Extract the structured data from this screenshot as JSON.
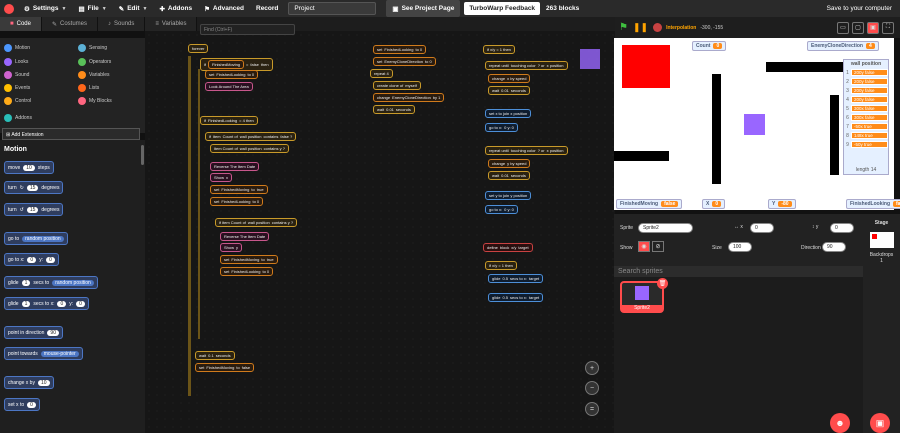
{
  "menu": {
    "settings": "Settings",
    "file": "File",
    "edit": "Edit",
    "addons": "Addons",
    "advanced": "Advanced",
    "record": "Record",
    "project_title": "Project",
    "see_project_page": "See Project Page",
    "feedback": "TurboWarp Feedback",
    "block_count": "263 blocks",
    "save": "Save to your computer"
  },
  "tabs": {
    "code": "Code",
    "costumes": "Costumes",
    "sounds": "Sounds",
    "variables": "Variables"
  },
  "find_placeholder": "Find (Ctrl+F)",
  "categories": [
    {
      "label": "Motion",
      "color": "#4c97ff"
    },
    {
      "label": "Looks",
      "color": "#9966ff"
    },
    {
      "label": "Sound",
      "color": "#cf63cf"
    },
    {
      "label": "Events",
      "color": "#ffbf00"
    },
    {
      "label": "Control",
      "color": "#ffab19"
    },
    {
      "label": "Sensing",
      "color": "#5cb1d6"
    },
    {
      "label": "Operators",
      "color": "#59c059"
    },
    {
      "label": "Variables",
      "color": "#ff8c1a"
    },
    {
      "label": "Lists",
      "color": "#ff661a"
    },
    {
      "label": "My Blocks",
      "color": "#ff6680"
    },
    {
      "label": "Addons",
      "color": "#29beb8"
    }
  ],
  "add_extension": "Add Extension",
  "palette": {
    "title": "Motion",
    "move": {
      "a": "move",
      "v": "10",
      "b": "steps"
    },
    "turn_right": {
      "a": "turn",
      "v": "15",
      "b": "degrees"
    },
    "turn_left": {
      "a": "turn",
      "v": "15",
      "b": "degrees"
    },
    "goto": {
      "a": "go to",
      "d": "random position"
    },
    "gotoxy": {
      "a": "go to x:",
      "x": "0",
      "b": "y:",
      "y": "0"
    },
    "glide_to": {
      "a": "glide",
      "v": "1",
      "b": "secs to",
      "d": "random position"
    },
    "glide_xy": {
      "a": "glide",
      "v": "1",
      "b": "secs to x:",
      "x": "0",
      "c": "y:",
      "y": "0"
    },
    "point_dir": {
      "a": "point in direction",
      "v": "90"
    },
    "point_towards": {
      "a": "point towards",
      "d": "mouse-pointer"
    },
    "change_x": {
      "a": "change x by",
      "v": "10"
    },
    "set_x": {
      "a": "set x to",
      "v": "0"
    }
  },
  "workspace": {
    "forever": "forever",
    "finished_moving": "FinishedMoving",
    "false": "false",
    "true": "true",
    "finished_looking": "FinishedLooking",
    "look_around": "Look Around The Area",
    "item": "item",
    "count": "Count",
    "wall_position": "wall position",
    "contains": "contains",
    "reverse": "Reverse The Item Date",
    "show": "Show",
    "wait": "wait",
    "seconds": "seconds",
    "wait_val": "0.1",
    "repeat_until": "repeat until",
    "touching": "touching color",
    "x_position": "x position",
    "go_to_x": "go to x:",
    "change": "change",
    "enemy_clone_dir": "EnemyCloneDirection",
    "create_clone": "create clone of",
    "myself": "myself",
    "define": "define",
    "block": "block",
    "target": "target",
    "glide": "glide",
    "secs_to_x": "secs to x:"
  },
  "stage_bar": {
    "interpolation": "Interpolation",
    "coords": "-300, -155"
  },
  "monitors": {
    "count": {
      "label": "Count",
      "value": "0"
    },
    "enemy_dir": {
      "label": "EnemyCloneDirection",
      "value": "4"
    },
    "finished_moving": {
      "label": "FinishedMoving",
      "value": "false"
    },
    "x": {
      "label": "X",
      "value": "0"
    },
    "y": {
      "label": "Y",
      "value": "-80"
    },
    "finished_looking": {
      "label": "FinishedLooking",
      "value": "false"
    }
  },
  "wall_list": {
    "title": "wall position",
    "items": [
      "200y false",
      "200y false",
      "200y false",
      "200y false",
      "300x false",
      "300x false",
      "-50x true",
      "148x true",
      "-50y true"
    ],
    "length": "length 14"
  },
  "sprite_info": {
    "sprite_label": "Sprite",
    "sprite_name": "Sprite2",
    "x_value": "0",
    "y_value": "0",
    "show_label": "Show",
    "size_label": "Size",
    "size_value": "100",
    "direction_label": "Direction",
    "direction_value": "90"
  },
  "search_sprites": "Search sprites",
  "sprite_thumb": "Sprite2",
  "stage_pane": {
    "stage": "Stage",
    "backdrops": "Backdrops",
    "count": "1"
  }
}
